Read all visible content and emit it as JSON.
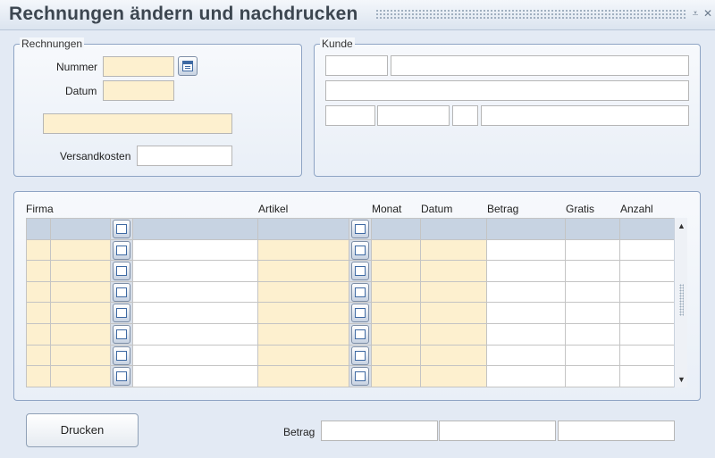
{
  "window": {
    "title": "Rechnungen ändern und nachdrucken",
    "minimize_symbol": "⩡",
    "close_symbol": "✕"
  },
  "rechnungen": {
    "legend": "Rechnungen",
    "nummer_label": "Nummer",
    "nummer_value": "",
    "datum_label": "Datum",
    "datum_value": "",
    "info_value": "",
    "versandkosten_label": "Versandkosten",
    "versandkosten_value": ""
  },
  "kunde": {
    "legend": "Kunde",
    "field_1": "",
    "field_2": "",
    "field_3": "",
    "field_4": "",
    "field_5": "",
    "field_6": "",
    "field_7": ""
  },
  "grid": {
    "headers": {
      "firma": "Firma",
      "artikel": "Artikel",
      "monat": "Monat",
      "datum": "Datum",
      "betrag": "Betrag",
      "gratis": "Gratis",
      "anzahl": "Anzahl"
    },
    "row_count": 8,
    "selected_row": 0
  },
  "footer": {
    "print_label": "Drucken",
    "betrag_label": "Betrag",
    "betrag_value_1": "",
    "betrag_value_2": "",
    "betrag_value_3": ""
  },
  "colors": {
    "input_highlight": "#fdf0cf",
    "selected_row": "#c7d3e2",
    "panel_border": "#8ea4c4"
  },
  "icons": {
    "calendar": "calendar-icon",
    "scroll_up": "scroll-up-arrow-icon",
    "scroll_down": "scroll-down-arrow-icon"
  }
}
